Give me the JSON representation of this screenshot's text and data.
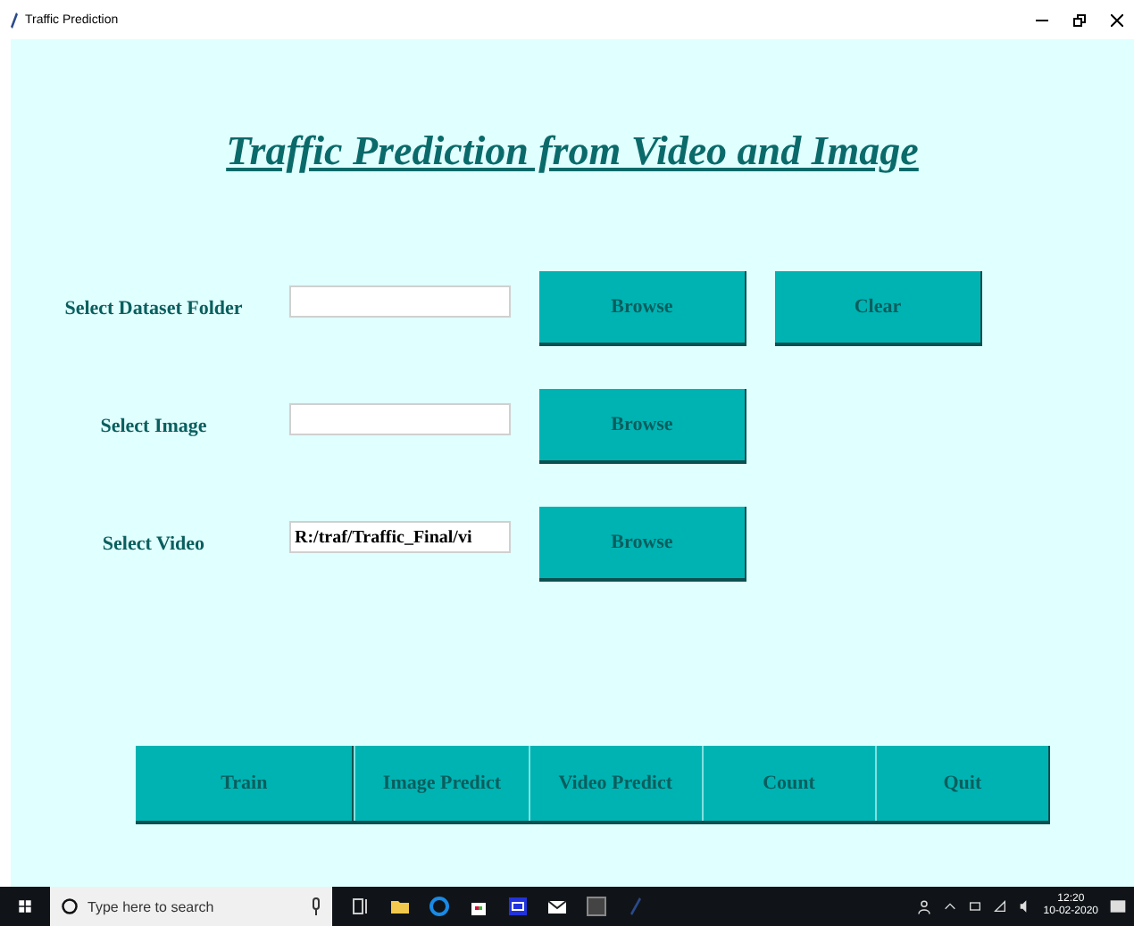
{
  "window": {
    "title": "Traffic Prediction"
  },
  "heading": "Traffic Prediction from Video and Image",
  "rows": [
    {
      "label": "Select Dataset Folder",
      "buttons": [
        "Browse",
        "Clear"
      ]
    },
    {
      "label": "Select Image",
      "buttons": [
        "Browse"
      ]
    },
    {
      "label": "Select Video",
      "value": "R:/traf/Traffic_Final/vi",
      "buttons": [
        "Browse"
      ]
    }
  ],
  "actions": [
    "Train",
    "Image Predict",
    "Video Predict",
    "Count",
    "Quit"
  ],
  "taskbar": {
    "search": {
      "placeholder": "Type here to search"
    },
    "time": "12:20",
    "date": "10-02-2020"
  }
}
